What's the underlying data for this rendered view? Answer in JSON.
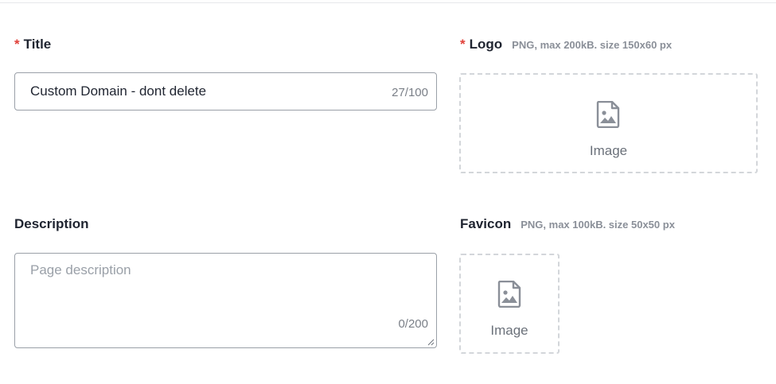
{
  "form": {
    "title": {
      "required_mark": "*",
      "label": "Title",
      "value": "Custom Domain - dont delete",
      "counter": "27/100"
    },
    "description": {
      "label": "Description",
      "placeholder": "Page description",
      "counter": "0/200"
    },
    "logo": {
      "required_mark": "*",
      "label": "Logo",
      "hint": "PNG, max 200kB. size 150x60 px",
      "upload_label": "Image",
      "icon": "image-icon"
    },
    "favicon": {
      "label": "Favicon",
      "hint": "PNG, max 100kB. size 50x50 px",
      "upload_label": "Image",
      "icon": "image-icon"
    }
  },
  "colors": {
    "required": "#e0413a",
    "border": "#9aa0a8",
    "dashed_border": "#d3d6da",
    "icon": "#8a8f98"
  }
}
